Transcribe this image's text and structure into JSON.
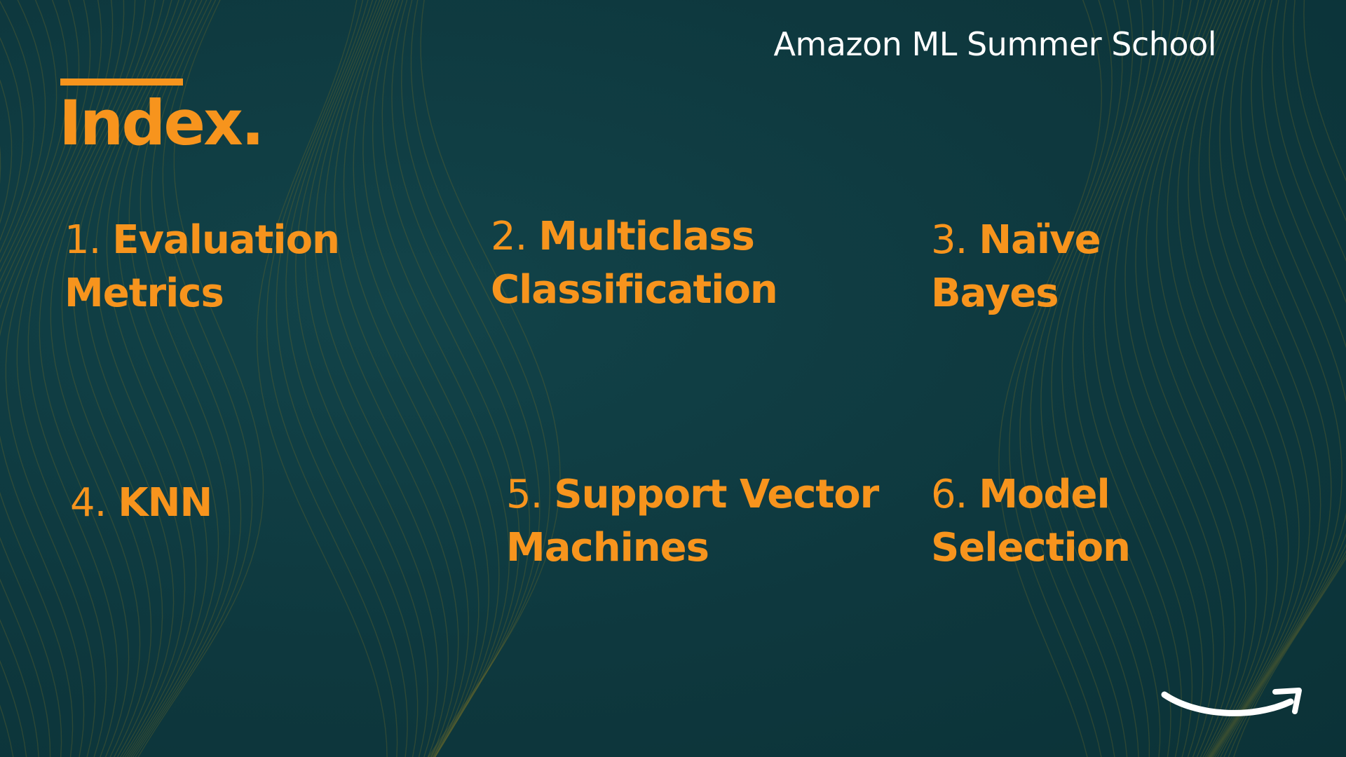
{
  "header": {
    "brand": "Amazon ML Summer School"
  },
  "heading": "Index.",
  "topics": [
    {
      "number": "1.",
      "title": "Evaluation Metrics"
    },
    {
      "number": "2.",
      "title": "Multiclass Classification"
    },
    {
      "number": "3.",
      "title": "Naïve Bayes"
    },
    {
      "number": "4.",
      "title": "KNN"
    },
    {
      "number": "5.",
      "title": "Support Vector Machines"
    },
    {
      "number": "6.",
      "title": "Model Selection"
    }
  ],
  "logo": {
    "icon": "amazon-smile-arrow-icon"
  },
  "colors": {
    "background": "#0f3a40",
    "accent": "#f7941d",
    "text_light": "#ffffff"
  }
}
